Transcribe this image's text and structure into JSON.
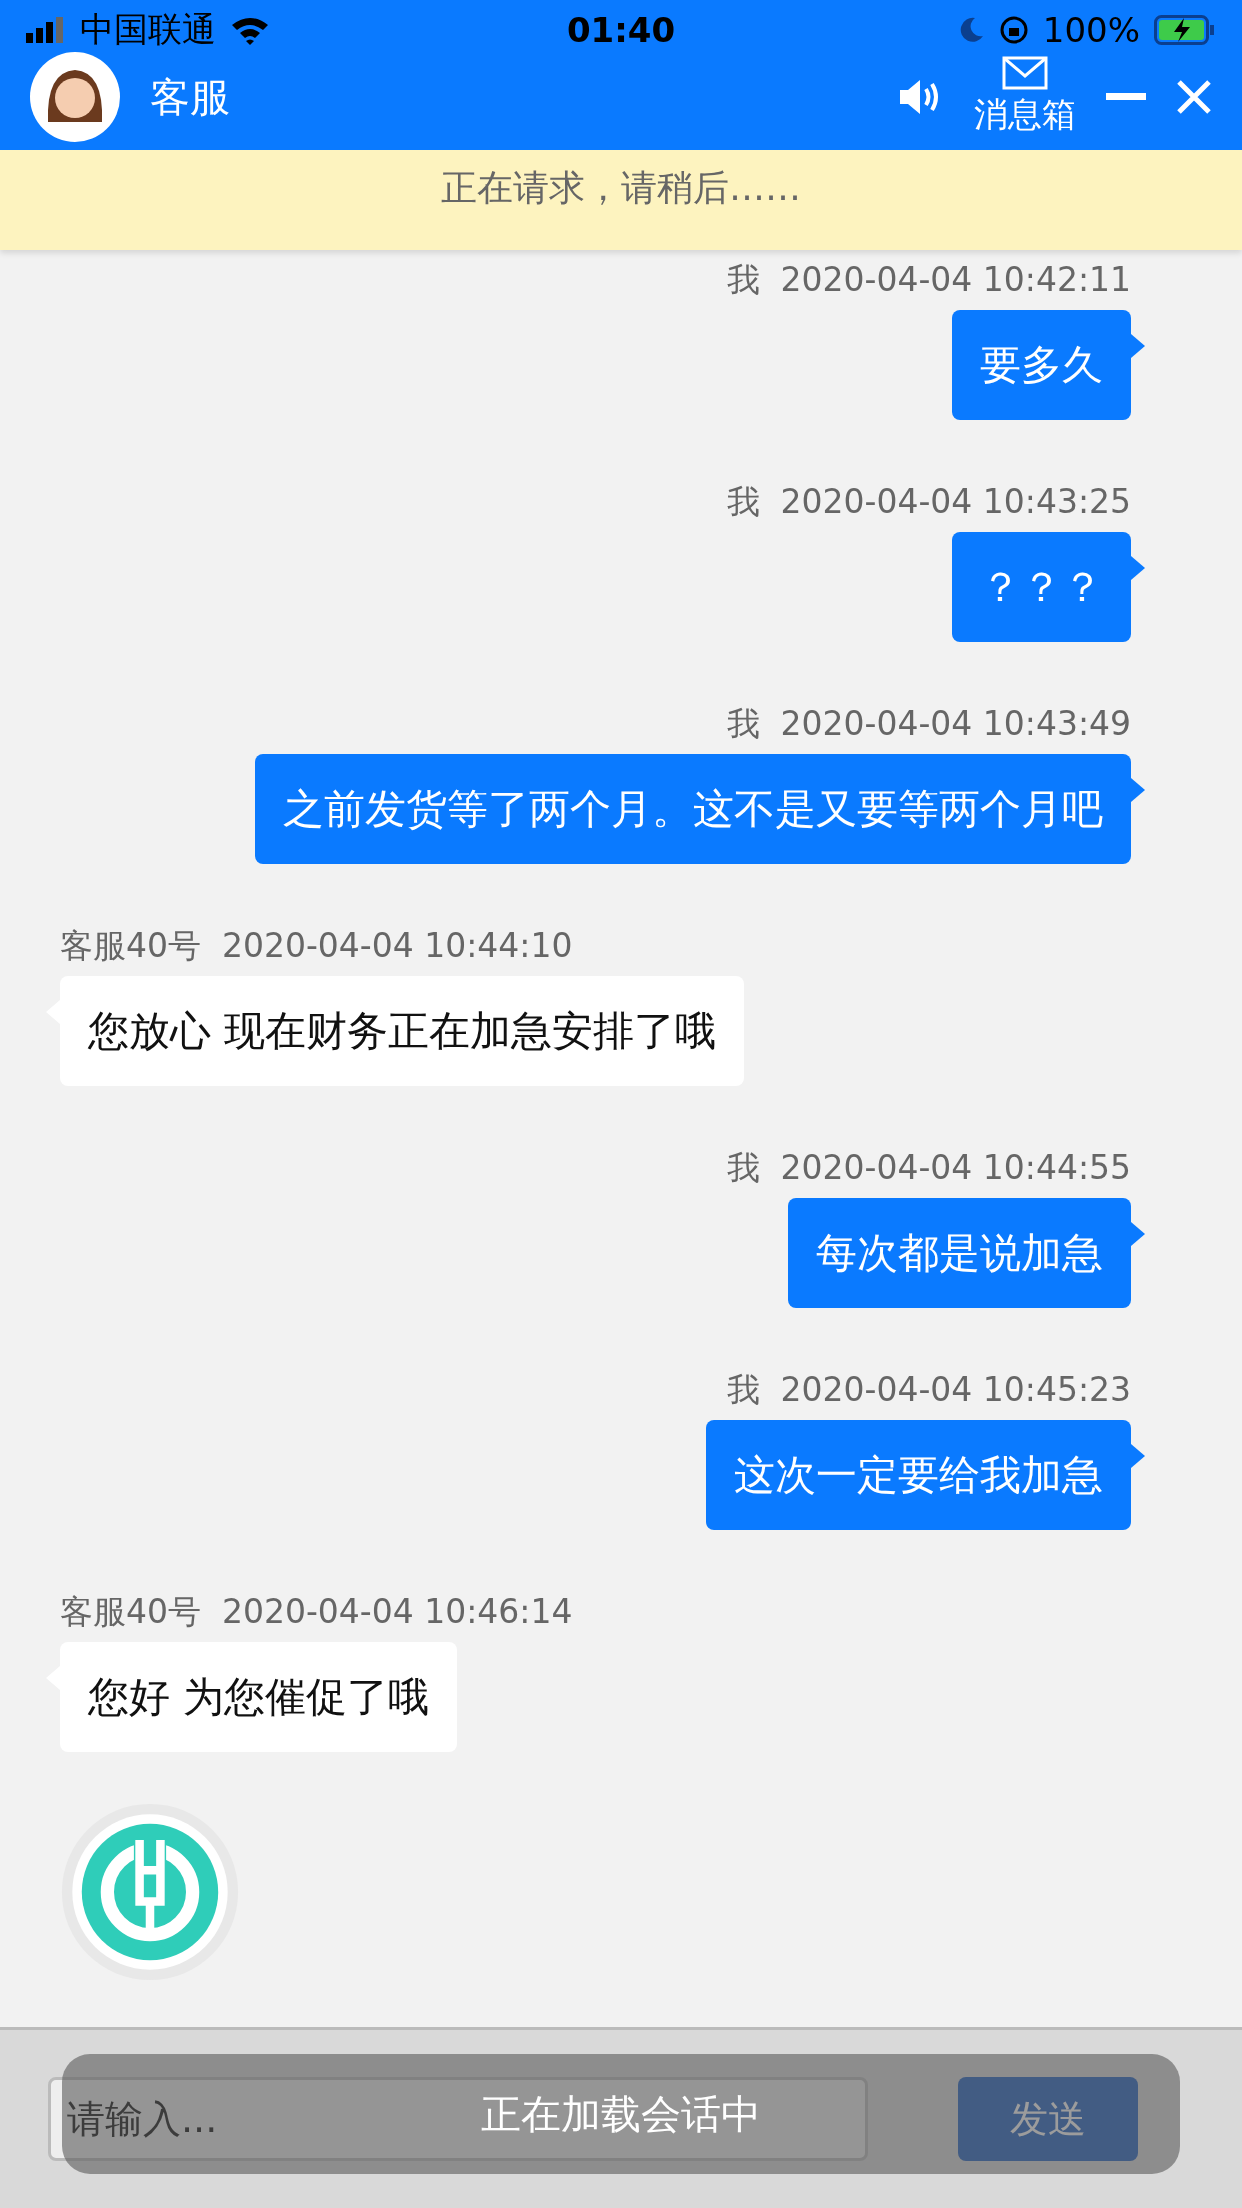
{
  "status_bar": {
    "carrier": "中国联通",
    "time": "01:40",
    "battery": "100%"
  },
  "header": {
    "title": "客服",
    "inbox_label": "消息箱"
  },
  "notice": "正在请求，请稍后……",
  "messages": [
    {
      "kind": "me",
      "sender": "我",
      "time": "2020-04-04 10:42:11",
      "text": "要多久"
    },
    {
      "kind": "me",
      "sender": "我",
      "time": "2020-04-04 10:43:25",
      "text": "？？？"
    },
    {
      "kind": "me",
      "sender": "我",
      "time": "2020-04-04 10:43:49",
      "text": "之前发货等了两个月。这不是又要等两个月吧"
    },
    {
      "kind": "agent",
      "sender": "客服40号",
      "time": "2020-04-04 10:44:10",
      "text": "您放心 现在财务正在加急安排了哦"
    },
    {
      "kind": "me",
      "sender": "我",
      "time": "2020-04-04 10:44:55",
      "text": "每次都是说加急"
    },
    {
      "kind": "me",
      "sender": "我",
      "time": "2020-04-04 10:45:23",
      "text": "这次一定要给我加急"
    },
    {
      "kind": "agent",
      "sender": "客服40号",
      "time": "2020-04-04 10:46:14",
      "text": "您好 为您催促了哦"
    },
    {
      "kind": "logo"
    }
  ],
  "input": {
    "placeholder": "请输入...",
    "send_label": "发送"
  },
  "toast": "正在加载会话中"
}
